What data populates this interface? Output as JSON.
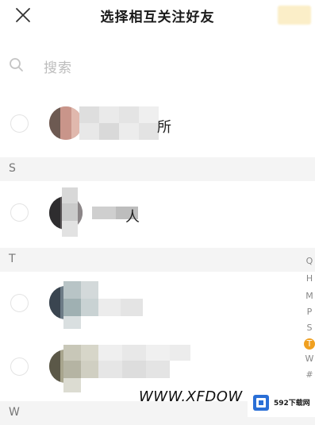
{
  "header": {
    "title": "选择相互关注好友",
    "close_icon": "close-icon"
  },
  "search": {
    "placeholder": "搜索",
    "icon": "search-icon"
  },
  "contacts": [
    {
      "name": "所"
    },
    {
      "name": "人"
    },
    {
      "name": ""
    },
    {
      "name": ""
    }
  ],
  "sections": [
    "S",
    "T",
    "W"
  ],
  "index_bar": [
    "Q",
    "H",
    "M",
    "P",
    "S",
    "T",
    "W",
    "#"
  ],
  "index_active": "T",
  "watermark": {
    "text": "WWW.XFDOW",
    "site": "592下载网"
  },
  "colors": {
    "accent": "#f0a020",
    "section_bg": "#f4f4f4",
    "confirm_bg": "#fbeec8"
  }
}
